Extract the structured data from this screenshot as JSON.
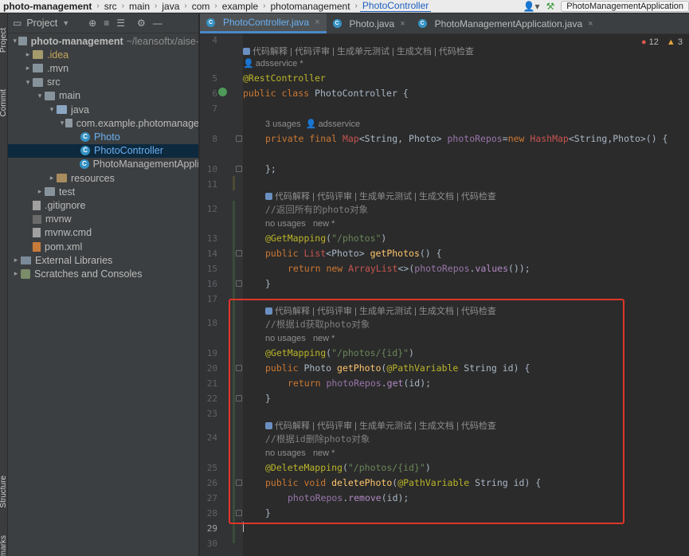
{
  "breadcrumb": [
    "photo-management",
    "src",
    "main",
    "java",
    "com",
    "example",
    "photomanagement",
    "PhotoController"
  ],
  "run_config": "PhotoManagementApplication",
  "left_strip": {
    "project": "Project",
    "commit": "Commit",
    "structure": "Structure",
    "bookmarks": "Bookmarks"
  },
  "project_panel": {
    "title": "Project",
    "tree": [
      {
        "label": "photo-management",
        "extra": "~/leansoftx/aise-",
        "arrow": "▾",
        "indent": 0,
        "icon": "folder",
        "bold": true
      },
      {
        "label": ".idea",
        "arrow": "▸",
        "indent": 1,
        "icon": "folder idea",
        "cls": "yellowish"
      },
      {
        "label": ".mvn",
        "arrow": "▸",
        "indent": 1,
        "icon": "folder"
      },
      {
        "label": "src",
        "arrow": "▾",
        "indent": 1,
        "icon": "folder"
      },
      {
        "label": "main",
        "arrow": "▾",
        "indent": 2,
        "icon": "folder"
      },
      {
        "label": "java",
        "arrow": "▾",
        "indent": 3,
        "icon": "folder src"
      },
      {
        "label": "com.example.photomanage",
        "arrow": "▾",
        "indent": 4,
        "icon": "folder pkg"
      },
      {
        "label": "Photo",
        "arrow": "",
        "indent": 5,
        "icon": "class",
        "cls": "blue"
      },
      {
        "label": "PhotoController",
        "arrow": "",
        "indent": 5,
        "icon": "class",
        "cls": "blue",
        "selected": true
      },
      {
        "label": "PhotoManagementAppli",
        "arrow": "",
        "indent": 5,
        "icon": "class"
      },
      {
        "label": "resources",
        "arrow": "▸",
        "indent": 3,
        "icon": "folder res"
      },
      {
        "label": "test",
        "arrow": "▸",
        "indent": 2,
        "icon": "folder"
      },
      {
        "label": ".gitignore",
        "arrow": "",
        "indent": 1,
        "icon": "file"
      },
      {
        "label": "mvnw",
        "arrow": "",
        "indent": 1,
        "icon": "sh"
      },
      {
        "label": "mvnw.cmd",
        "arrow": "",
        "indent": 1,
        "icon": "file"
      },
      {
        "label": "pom.xml",
        "arrow": "",
        "indent": 1,
        "icon": "xml"
      },
      {
        "label": "External Libraries",
        "arrow": "▸",
        "indent": 0,
        "icon": "lib"
      },
      {
        "label": "Scratches and Consoles",
        "arrow": "▸",
        "indent": 0,
        "icon": "scratch"
      }
    ]
  },
  "tabs": [
    {
      "label": "PhotoController.java",
      "active": true
    },
    {
      "label": "Photo.java",
      "active": false
    },
    {
      "label": "PhotoManagementApplication.java",
      "active": false
    }
  ],
  "inspections": {
    "errors": "12",
    "warnings": "3"
  },
  "editor": {
    "ai_hint": "代码解释 | 代码评审 | 生成单元测试 | 生成文档 | 代码检查",
    "author_adsservice": "adsservice *",
    "usages_3": "3 usages",
    "usages_author": "adsservice",
    "no_usages": "no usages",
    "new_mark": "new *",
    "line_numbers": [
      "4",
      "5",
      "6",
      "7",
      "8",
      "10",
      "11",
      "12",
      "13",
      "14",
      "15",
      "16",
      "17",
      "18",
      "19",
      "20",
      "21",
      "22",
      "23",
      "24",
      "25",
      "26",
      "27",
      "28",
      "29",
      "30"
    ],
    "code": {
      "l5": "@RestController",
      "l6_kw": "public class",
      "l6_name": " PhotoController {",
      "l8_a": "private final ",
      "l8_type": "Map",
      "l8_b": "<String, Photo> ",
      "l8_field": "photoRepos",
      "l8_c": "=",
      "l8_new": "new ",
      "l8_hm": "HashMap",
      "l8_d": "<String,Photo>() {",
      "l10": "};",
      "c12": "//返回所有的photo对象",
      "l13_ann": "@GetMapping",
      "l13_str": "\"/photos\"",
      "l14_kw": "public ",
      "l14_type": "List",
      "l14_b": "<Photo> ",
      "l14_fn": "getPhotos",
      "l14_c": "() {",
      "l15_kw": "return new ",
      "l15_al": "ArrayList",
      "l15_b": "<>(",
      "l15_f": "photoRepos",
      "l15_c": ".",
      "l15_m": "values",
      "l15_d": "());",
      "l16": "}",
      "c18": "//根据id获取photo对象",
      "l19_ann": "@GetMapping",
      "l19_str": "\"/photos/{id}\"",
      "l20_kw": "public ",
      "l20_b": "Photo ",
      "l20_fn": "getPhoto",
      "l20_c": "(",
      "l20_ann": "@PathVariable",
      "l20_d": " String id) {",
      "l21_kw": "return ",
      "l21_f": "photoRepos",
      "l21_c": ".",
      "l21_m": "get",
      "l21_d": "(id);",
      "l22": "}",
      "c24": "//根据id删除photo对象",
      "l25_ann": "@DeleteMapping",
      "l25_str": "\"/photos/{id}\"",
      "l26_kw": "public void ",
      "l26_fn": "deletePhoto",
      "l26_c": "(",
      "l26_ann": "@PathVariable",
      "l26_d": " String id) {",
      "l27_f": "photoRepos",
      "l27_c": ".",
      "l27_m": "remove",
      "l27_d": "(id);",
      "l28": "}"
    }
  }
}
